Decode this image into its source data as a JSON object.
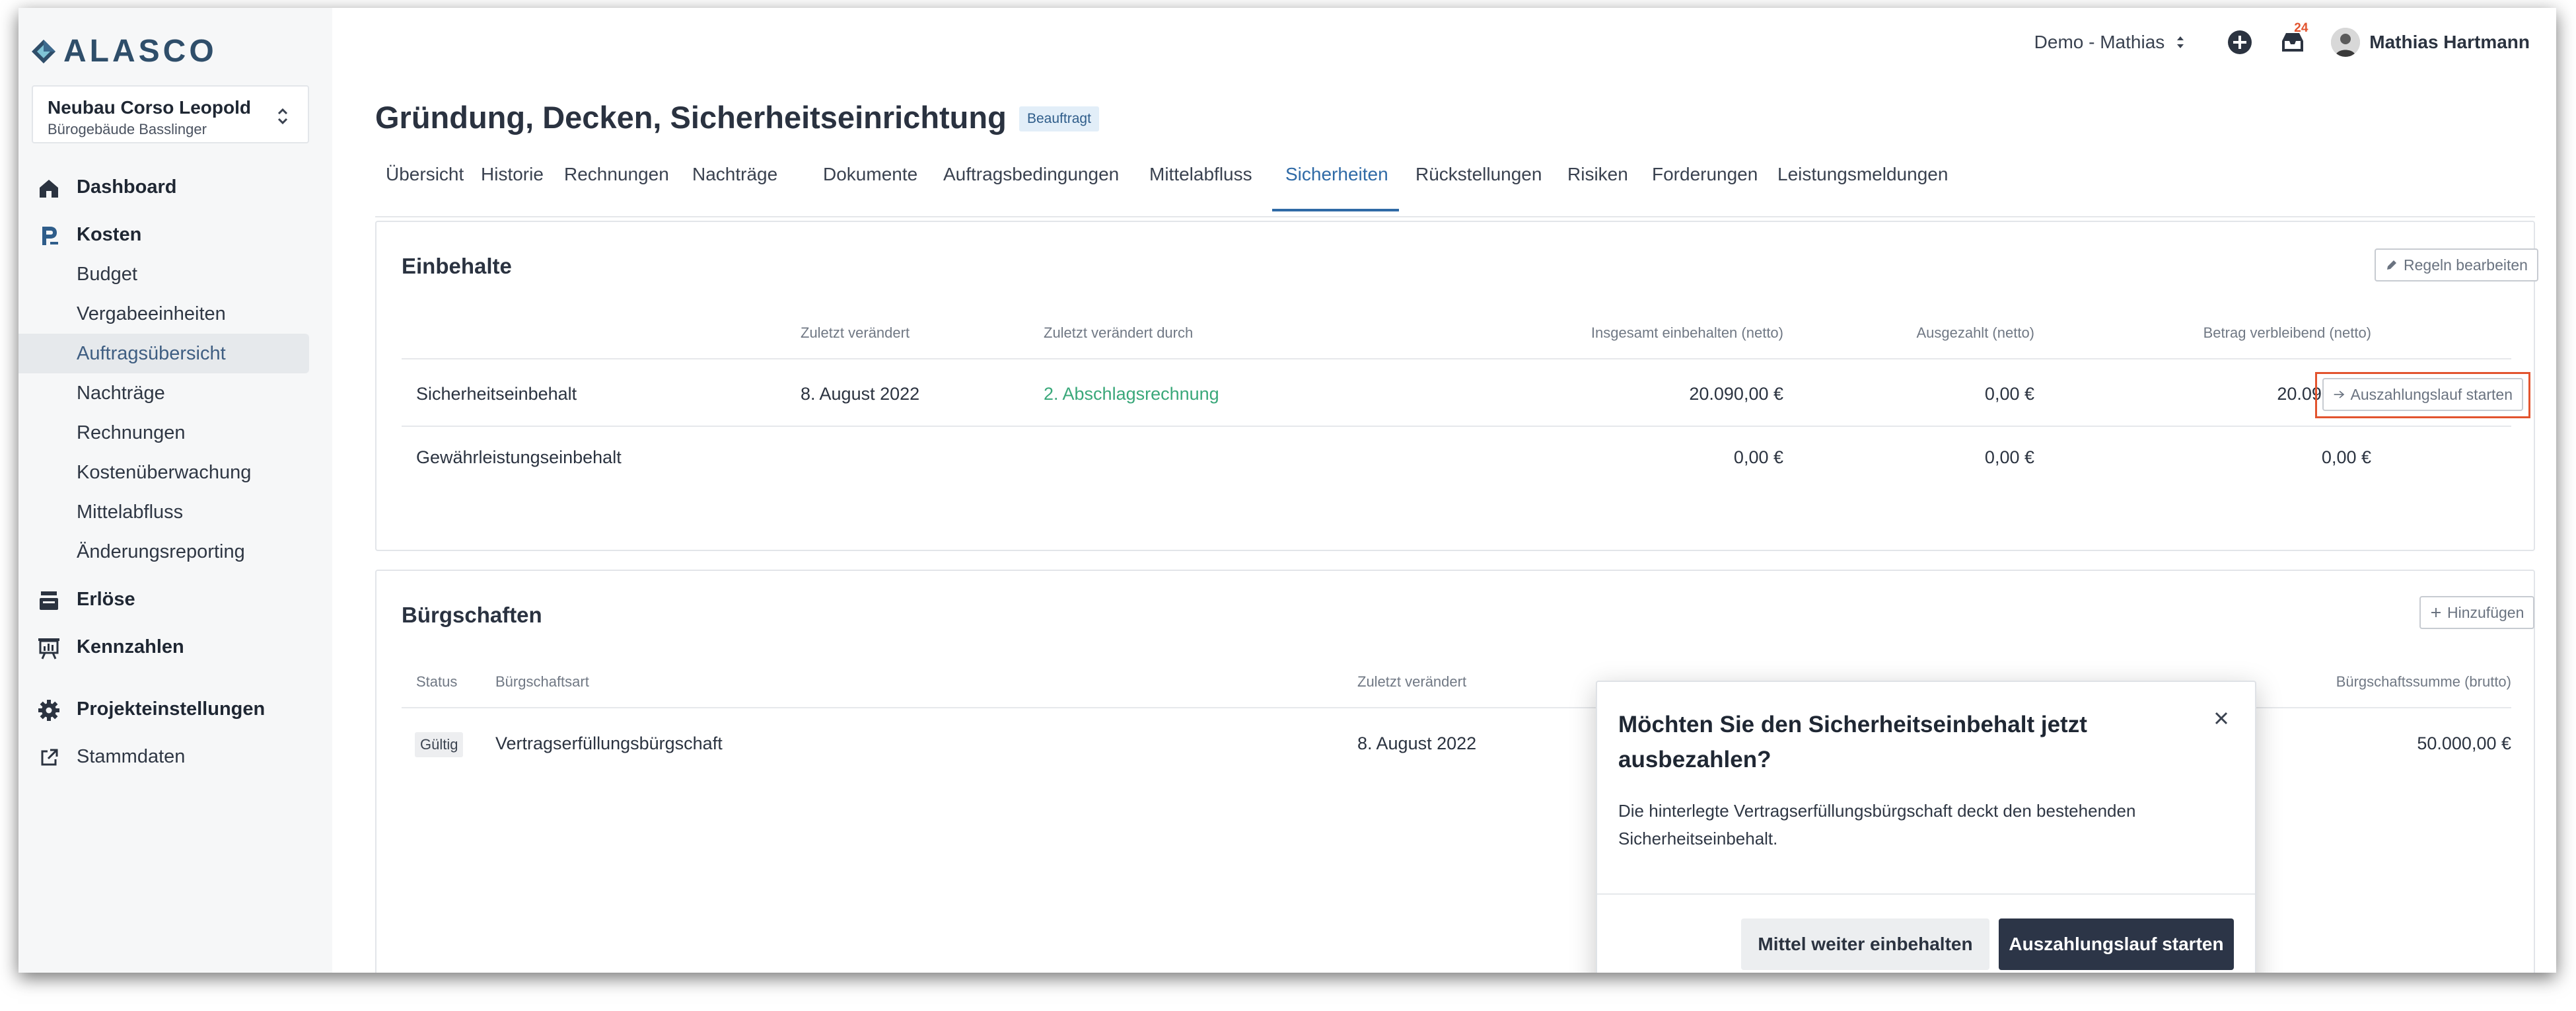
{
  "brand": {
    "name": "ALASCO"
  },
  "project": {
    "name": "Neubau Corso Leopold",
    "building": "Bürogebäude Basslinger"
  },
  "nav": {
    "dashboard": "Dashboard",
    "kosten": "Kosten",
    "kosten_items": [
      "Budget",
      "Vergabeeinheiten",
      "Auftragsübersicht",
      "Nachträge",
      "Rechnungen",
      "Kostenüberwachung",
      "Mittelabfluss",
      "Änderungsreporting"
    ],
    "active_item": "Auftragsübersicht",
    "erloese": "Erlöse",
    "kennzahlen": "Kennzahlen",
    "projekteinstellungen": "Projekteinstellungen",
    "stammdaten": "Stammdaten"
  },
  "topbar": {
    "workspace": "Demo - Mathias",
    "notification_count": "24",
    "user_name": "Mathias Hartmann"
  },
  "page": {
    "title": "Gründung, Decken, Sicherheitseinrichtung",
    "status": "Beauftragt"
  },
  "tabs": [
    "Übersicht",
    "Historie",
    "Rechnungen",
    "Nachträge",
    "Dokumente",
    "Auftragsbedingungen",
    "Mittelabfluss",
    "Sicherheiten",
    "Rückstellungen",
    "Risiken",
    "Forderungen",
    "Leistungsmeldungen"
  ],
  "active_tab": "Sicherheiten",
  "einbehalte": {
    "title": "Einbehalte",
    "edit_button": "Regeln bearbeiten",
    "columns": [
      "Zuletzt verändert",
      "Zuletzt verändert durch",
      "Insgesamt einbehalten (netto)",
      "Ausgezahlt (netto)",
      "Betrag verbleibend (netto)"
    ],
    "rows": [
      {
        "name": "Sicherheitseinbehalt",
        "changed": "8. August 2022",
        "changed_by": "2. Abschlagsrechnung",
        "total": "20.090,00 €",
        "paid": "0,00 €",
        "remaining": "20.090,00 €",
        "action": "Auszahlungslauf starten"
      },
      {
        "name": "Gewährleistungseinbehalt",
        "changed": "",
        "changed_by": "",
        "total": "0,00 €",
        "paid": "0,00 €",
        "remaining": "0,00 €",
        "action": ""
      }
    ]
  },
  "buergschaften": {
    "title": "Bürgschaften",
    "add_button": "Hinzufügen",
    "columns": [
      "Status",
      "Bürgschaftsart",
      "Zuletzt verändert",
      "Bürgschaftssumme (brutto)"
    ],
    "rows": [
      {
        "status": "Gültig",
        "type": "Vertragserfüllungsbürgschaft",
        "changed": "8. August 2022",
        "sum": "50.000,00 €"
      }
    ]
  },
  "dialog": {
    "title": "Möchten Sie den Sicherheitseinbehalt jetzt ausbezahlen?",
    "text": "Die hinterlegte Vertragserfüllungsbürgschaft deckt den bestehenden Sicherheitseinbehalt.",
    "secondary": "Mittel weiter einbehalten",
    "primary": "Auszahlungslauf starten"
  },
  "colors": {
    "accent": "#2f6aa6",
    "link": "#3aa87a",
    "primary_button": "#2c3547",
    "highlight": "#e2542f"
  }
}
